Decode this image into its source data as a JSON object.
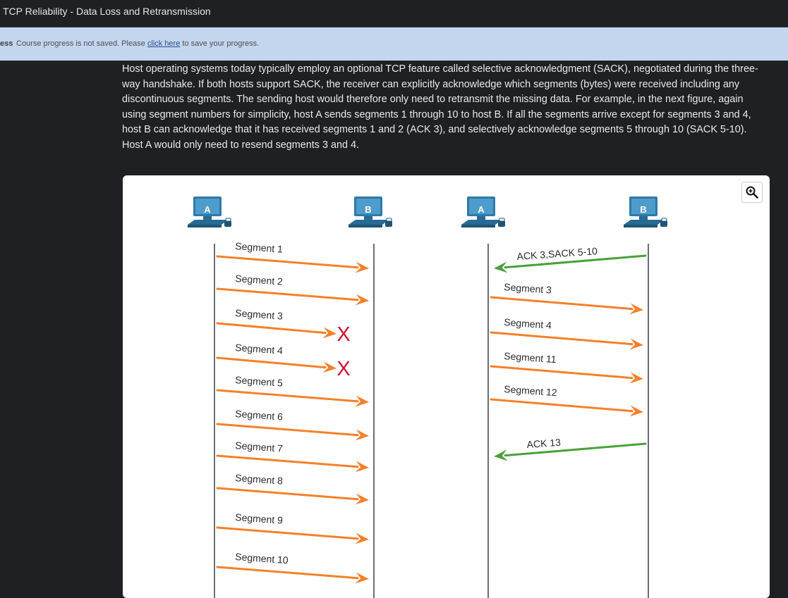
{
  "window": {
    "title": "TCP Reliability - Data Loss and Retransmission"
  },
  "banner": {
    "prefix": "ess",
    "message_before": "Course progress is not saved. Please ",
    "link_text": "click here",
    "message_after": " to save your progress."
  },
  "content": {
    "paragraph": "Host operating systems today typically employ an optional TCP feature called selective acknowledgment (SACK), negotiated during the three-way handshake. If both hosts support SACK, the receiver can explicitly acknowledge which segments (bytes) were received including any discontinuous segments. The sending host would therefore only need to retransmit the missing data. For example, in the next figure, again using segment numbers for simplicity, host A sends segments 1 through 10 to host B. If all the segments arrive except for segments 3 and 4, host B can acknowledge that it has received segments 1 and 2 (ACK 3), and selectively acknowledge segments 5 through 10 (SACK 5-10). Host A would only need to resend segments 3 and 4."
  },
  "figure": {
    "zoom_icon": "zoom-in-icon",
    "host_icon": "desktop-computer-icon",
    "colors": {
      "data": "#f5802a",
      "ack": "#4aa03a",
      "lost": "#c8102e",
      "monitor": "#2f7aa8",
      "line": "#6b6f74"
    },
    "left": {
      "hosts": [
        "A",
        "B"
      ],
      "lost_mark": "X",
      "segments": [
        {
          "label": "Segment 1",
          "lost": false
        },
        {
          "label": "Segment 2",
          "lost": false
        },
        {
          "label": "Segment 3",
          "lost": true
        },
        {
          "label": "Segment 4",
          "lost": true
        },
        {
          "label": "Segment 5",
          "lost": false
        },
        {
          "label": "Segment 6",
          "lost": false
        },
        {
          "label": "Segment 7",
          "lost": false
        },
        {
          "label": "Segment 8",
          "lost": false
        },
        {
          "label": "Segment 9",
          "lost": false
        },
        {
          "label": "Segment 10",
          "lost": false
        }
      ]
    },
    "right": {
      "hosts": [
        "A",
        "B"
      ],
      "messages": [
        {
          "label": "ACK 3,SACK 5-10",
          "direction": "B-to-A"
        },
        {
          "label": "Segment 3",
          "direction": "A-to-B"
        },
        {
          "label": "Segment 4",
          "direction": "A-to-B"
        },
        {
          "label": "Segment 11",
          "direction": "A-to-B"
        },
        {
          "label": "Segment 12",
          "direction": "A-to-B"
        },
        {
          "label": "ACK 13",
          "direction": "B-to-A"
        }
      ]
    }
  }
}
